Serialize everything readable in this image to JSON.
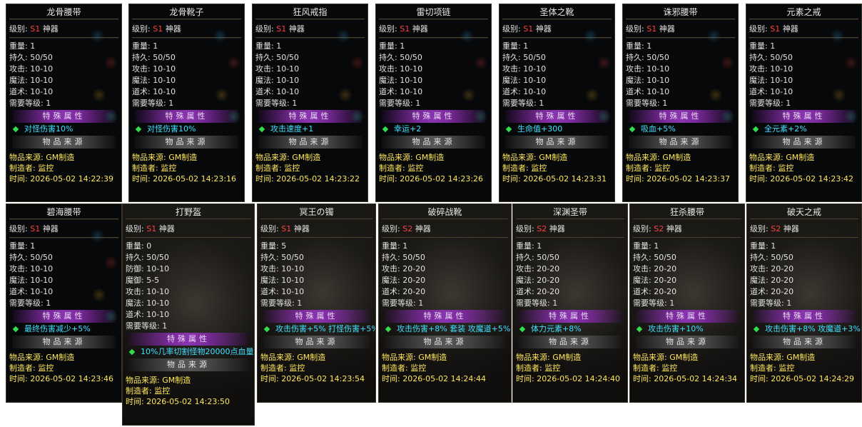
{
  "labels": {
    "grade": "级别:",
    "weight": "重量:",
    "durability": "持久:",
    "defense": "防御:",
    "mdefense": "魔御:",
    "attack": "攻击:",
    "magic": "魔法:",
    "tao": "道术:",
    "level": "需要等级:",
    "special": "特殊属性",
    "origin_bar": "物品来源",
    "source": "物品来源:",
    "maker": "制造者:",
    "time": "时间:"
  },
  "cards": [
    {
      "name": "龙骨腰带",
      "tier": "S1",
      "class": "神器",
      "weight": "1",
      "dur": "50/50",
      "atk": "10-10",
      "mag": "10-10",
      "tao": "10-10",
      "lvl": "1",
      "attr": "对怪伤害10%",
      "source": "GM制造",
      "maker": "监控",
      "time": "2026-05-02 14:22:39"
    },
    {
      "name": "龙骨靴子",
      "tier": "S1",
      "class": "神器",
      "weight": "1",
      "dur": "50/50",
      "atk": "10-10",
      "mag": "10-10",
      "tao": "10-10",
      "lvl": "1",
      "attr": "对怪伤害10%",
      "source": "GM制造",
      "maker": "监控",
      "time": "2026-05-02 14:23:16"
    },
    {
      "name": "狂风戒指",
      "tier": "S1",
      "class": "神器",
      "weight": "1",
      "dur": "50/50",
      "atk": "10-10",
      "mag": "10-10",
      "tao": "10-10",
      "lvl": "1",
      "attr": "攻击速度+1",
      "source": "GM制造",
      "maker": "监控",
      "time": "2026-05-02 14:23:22"
    },
    {
      "name": "雷切项链",
      "tier": "S1",
      "class": "神器",
      "weight": "1",
      "dur": "50/50",
      "atk": "10-10",
      "mag": "10-10",
      "tao": "10-10",
      "lvl": "1",
      "attr": "幸运+2",
      "source": "GM制造",
      "maker": "监控",
      "time": "2026-05-02 14:23:26"
    },
    {
      "name": "圣体之靴",
      "tier": "S1",
      "class": "神器",
      "weight": "1",
      "dur": "50/50",
      "atk": "10-10",
      "mag": "10-10",
      "tao": "10-10",
      "lvl": "1",
      "attr": "生命值+300",
      "source": "GM制造",
      "maker": "监控",
      "time": "2026-05-02 14:23:31"
    },
    {
      "name": "诛邪腰带",
      "tier": "S1",
      "class": "神器",
      "weight": "1",
      "dur": "50/50",
      "atk": "10-10",
      "mag": "10-10",
      "tao": "10-10",
      "lvl": "1",
      "attr": "吸血+5%",
      "source": "GM制造",
      "maker": "监控",
      "time": "2026-05-02 14:23:37"
    },
    {
      "name": "元素之戒",
      "tier": "S1",
      "class": "神器",
      "weight": "1",
      "dur": "50/50",
      "atk": "10-10",
      "mag": "10-10",
      "tao": "10-10",
      "lvl": "1",
      "attr": "全元素+2%",
      "source": "GM制造",
      "maker": "监控",
      "time": "2026-05-02 14:23:42"
    },
    {
      "name": "碧海腰带",
      "tier": "S1",
      "class": "神器",
      "weight": "1",
      "dur": "50/50",
      "atk": "10-10",
      "mag": "10-10",
      "tao": "10-10",
      "lvl": "1",
      "attr": "最终伤害减少+5%",
      "source": "GM制造",
      "maker": "监控",
      "time": "2026-05-02 14:23:46"
    },
    {
      "name": "打野盔",
      "tier": "S1",
      "class": "神器",
      "weight": "0",
      "dur": "50/50",
      "def": "10-10",
      "mdef": "5-5",
      "atk": "10-10",
      "mag": "10-10",
      "tao": "10-10",
      "lvl": "1",
      "attr": "10%几率切割怪物20000点血量",
      "source": "GM制造",
      "maker": "监控",
      "time": "2026-05-02 14:23:50"
    },
    {
      "name": "冥王の镯",
      "tier": "S1",
      "class": "神器",
      "weight": "5",
      "dur": "50/50",
      "atk": "10-10",
      "mag": "10-10",
      "tao": "10-10",
      "lvl": "1",
      "attr": "攻击伤害+5% 打怪伤害+5%",
      "source": "GM制造",
      "maker": "监控",
      "time": "2026-05-02 14:23:54"
    },
    {
      "name": "破碎战靴",
      "tier": "S2",
      "class": "神器",
      "weight": "1",
      "dur": "50/50",
      "atk": "20-20",
      "mag": "20-20",
      "tao": "20-20",
      "lvl": "1",
      "attr": "攻击伤害+8% 套装 攻魔道+5%",
      "source": "GM制造",
      "maker": "监控",
      "time": "2026-05-02 14:24:44"
    },
    {
      "name": "深渊圣带",
      "tier": "S2",
      "class": "神器",
      "weight": "1",
      "dur": "50/50",
      "atk": "20-20",
      "mag": "20-20",
      "tao": "20-20",
      "lvl": "1",
      "attr": "体力元素+8%",
      "source": "GM制造",
      "maker": "监控",
      "time": "2026-05-02 14:24:40"
    },
    {
      "name": "狂杀腰带",
      "tier": "S2",
      "class": "神器",
      "weight": "1",
      "dur": "50/50",
      "atk": "20-20",
      "mag": "20-20",
      "tao": "20-20",
      "lvl": "1",
      "attr": "攻击伤害+10%",
      "source": "GM制造",
      "maker": "监控",
      "time": "2026-05-02 14:24:34"
    },
    {
      "name": "破天之戒",
      "tier": "S2",
      "class": "神器",
      "weight": "1",
      "dur": "50/50",
      "atk": "20-20",
      "mag": "20-20",
      "tao": "20-20",
      "lvl": "1",
      "attr": "攻击伤害+8% 攻魔道+3%",
      "source": "GM制造",
      "maker": "监控",
      "time": "2026-05-02 14:24:29"
    }
  ]
}
